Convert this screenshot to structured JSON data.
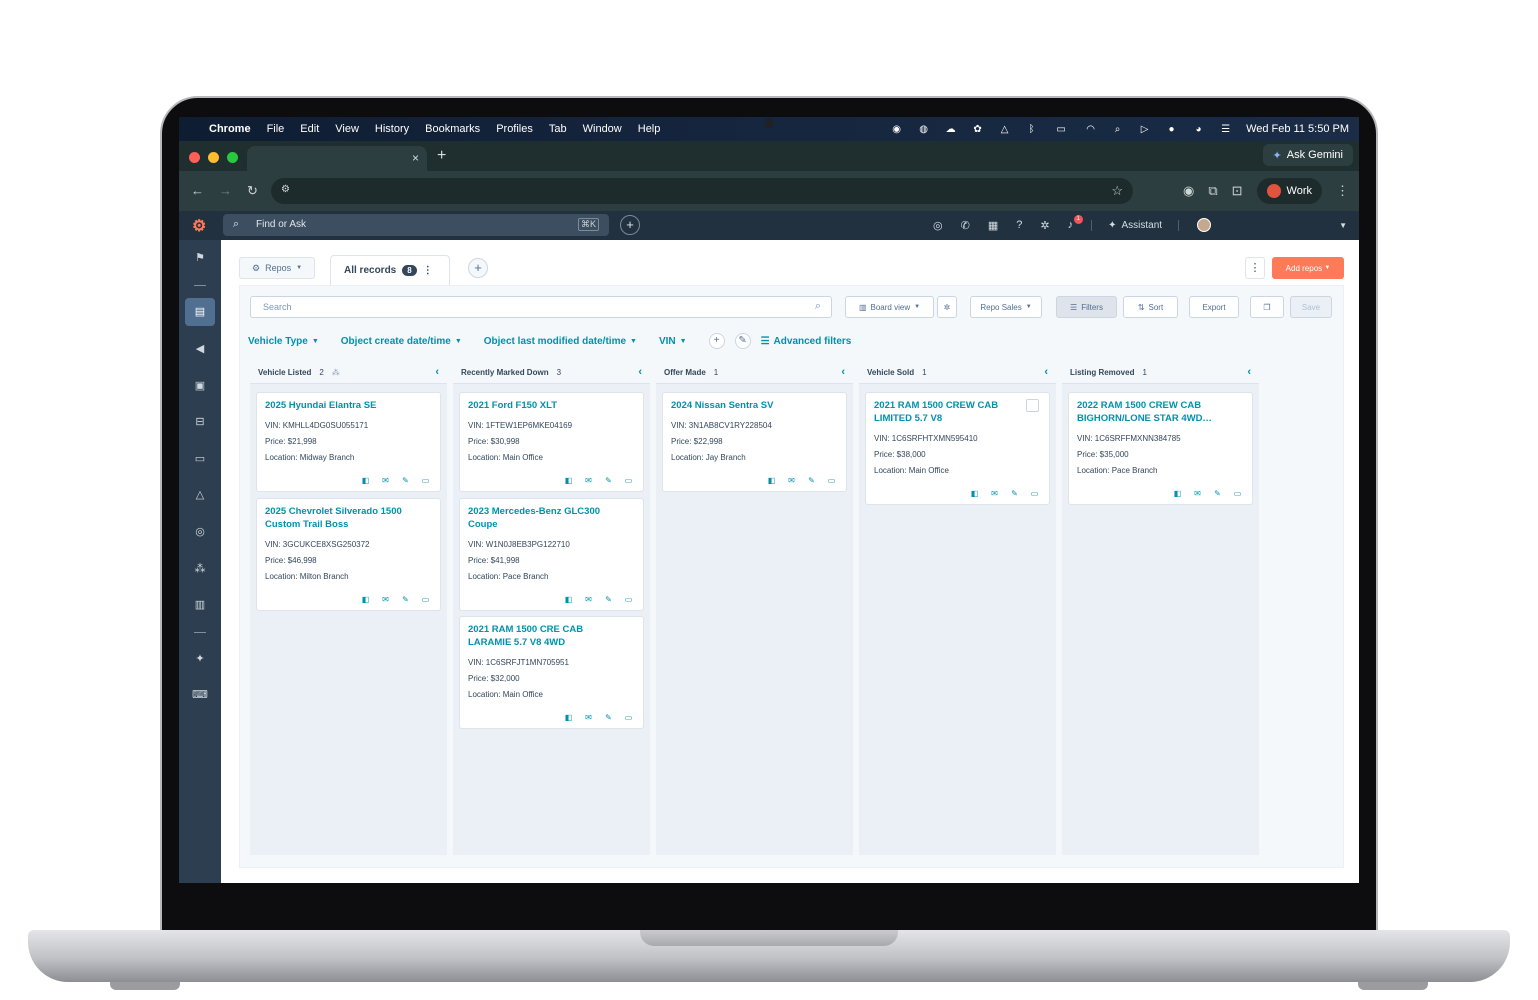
{
  "menubar": {
    "app": "Chrome",
    "items": [
      "File",
      "Edit",
      "View",
      "History",
      "Bookmarks",
      "Profiles",
      "Tab",
      "Window",
      "Help"
    ],
    "clock": "Wed Feb 11  5:50 PM",
    "status_icons": [
      "grammarly-icon",
      "zoom-icon",
      "cloud-icon",
      "openai-icon",
      "drive-icon",
      "bluetooth-icon",
      "battery-icon",
      "wifi-icon",
      "spotlight-icon",
      "play-icon",
      "record-icon",
      "chrome-profile-icon",
      "control-center-icon"
    ]
  },
  "browser": {
    "tab_close": "×",
    "new_tab": "+",
    "ask_gemini": "Ask Gemini",
    "profile": "Work"
  },
  "hubspot": {
    "search_placeholder": "Find or Ask",
    "search_shortcut": "⌘K",
    "assistant": "Assistant",
    "notification_count": "1"
  },
  "page": {
    "object_selector": "Repos",
    "view_tab": "All records",
    "view_count": "8",
    "add_button": "Add repos",
    "search_placeholder": "Search",
    "toolbar": {
      "board_view": "Board view",
      "pipeline": "Repo Sales",
      "filters": "Filters",
      "sort": "Sort",
      "export": "Export",
      "save": "Save"
    },
    "filters": [
      "Vehicle Type",
      "Object create date/time",
      "Object last modified date/time",
      "VIN"
    ],
    "advanced_filters": "Advanced filters"
  },
  "board": {
    "columns": [
      {
        "title": "Vehicle Listed",
        "count": "2",
        "cards": [
          {
            "name": "2025 Hyundai Elantra SE",
            "vin": "VIN: KMHLL4DG0SU055171",
            "price": "Price: $21,998",
            "location": "Location: Midway Branch"
          },
          {
            "name": "2025 Chevrolet Silverado 1500 Custom Trail Boss",
            "vin": "VIN: 3GCUKCE8XSG250372",
            "price": "Price: $46,998",
            "location": "Location: Milton Branch"
          }
        ]
      },
      {
        "title": "Recently Marked Down",
        "count": "3",
        "cards": [
          {
            "name": "2021 Ford F150 XLT",
            "vin": "VIN: 1FTEW1EP6MKE04169",
            "price": "Price: $30,998",
            "location": "Location: Main Office"
          },
          {
            "name": "2023 Mercedes-Benz GLC300 Coupe",
            "vin": "VIN: W1N0J8EB3PG122710",
            "price": "Price: $41,998",
            "location": "Location: Pace Branch"
          },
          {
            "name": "2021 RAM 1500 CRE CAB LARAMIE 5.7 V8 4WD",
            "vin": "VIN: 1C6SRFJT1MN705951",
            "price": "Price: $32,000",
            "location": "Location: Main Office"
          }
        ]
      },
      {
        "title": "Offer Made",
        "count": "1",
        "cards": [
          {
            "name": "2024 Nissan Sentra SV",
            "vin": "VIN: 3N1AB8CV1RY228504",
            "price": "Price: $22,998",
            "location": "Location: Jay Branch"
          }
        ]
      },
      {
        "title": "Vehicle Sold",
        "count": "1",
        "cards": [
          {
            "name": "2021 RAM 1500 CREW CAB LIMITED 5.7 V8",
            "vin": "VIN: 1C6SRFHTXMN595410",
            "price": "Price: $38,000",
            "location": "Location: Main Office"
          }
        ]
      },
      {
        "title": "Listing Removed",
        "count": "1",
        "cards": [
          {
            "name": "2022 RAM 1500 CREW CAB BIGHORN/LONE STAR 4WD…",
            "vin": "VIN: 1C6SRFFMXNN384785",
            "price": "Price: $35,000",
            "location": "Location: Pace Branch"
          }
        ]
      }
    ]
  }
}
